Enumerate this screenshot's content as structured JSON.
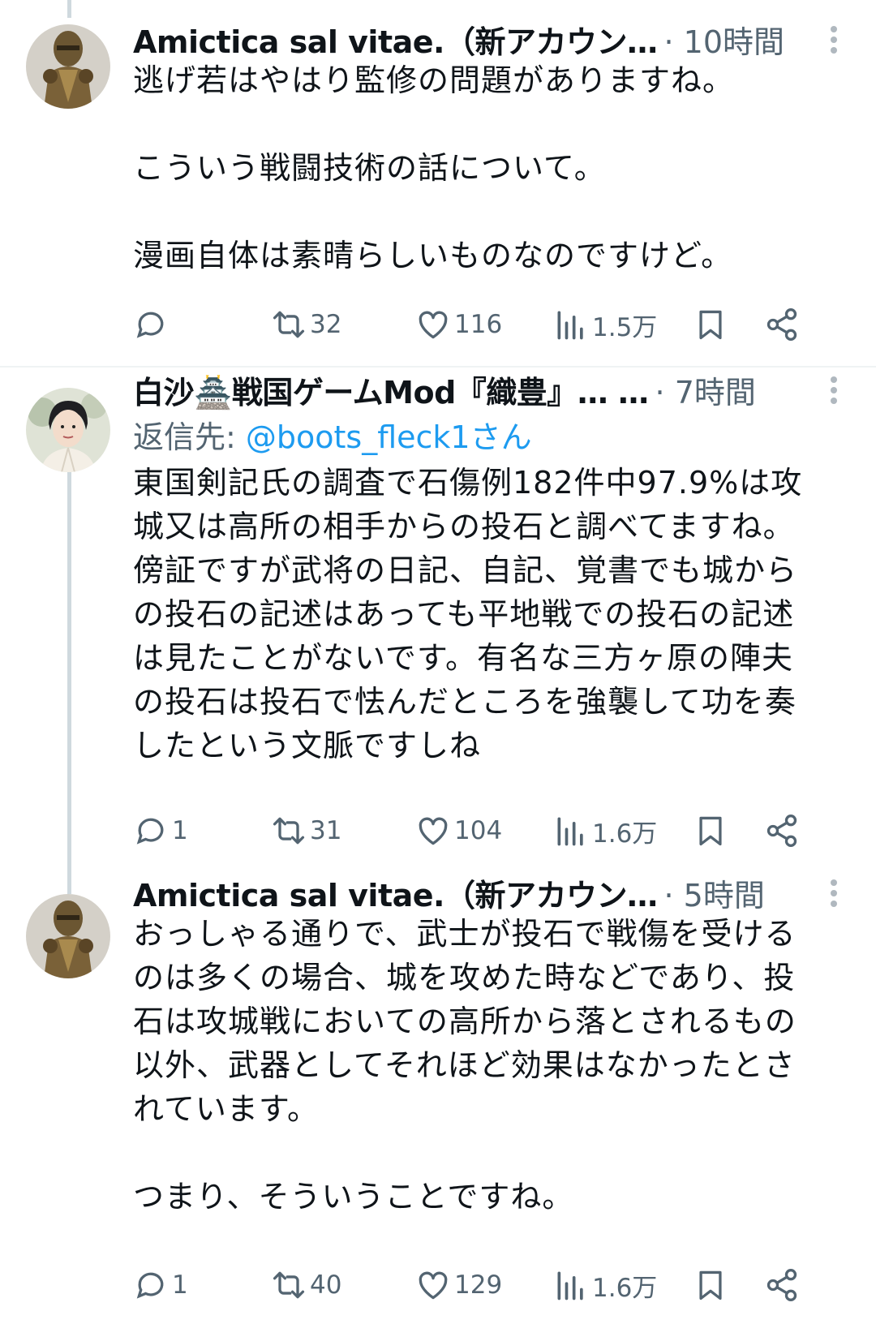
{
  "tweets": [
    {
      "name": "Amictica sal vitae.（新アカウン…",
      "time": "· 10時間",
      "lines": [
        "逃げ若はやはり監修の問題がありますね。",
        "",
        "こういう戦闘技術の話について。",
        "",
        "漫画自体は素晴らしいものなのですけど。"
      ],
      "stats": {
        "replies": "",
        "retweets": "32",
        "likes": "116",
        "views": "1.5万"
      },
      "avatar": "armor-avatar-icon"
    },
    {
      "name": "白沙🏯戦国ゲームMod『織豊』… …",
      "time": "· 7時間",
      "reply_prefix": "返信先: ",
      "reply_handle": "@boots_fleck1さん",
      "lines": [
        "東国剣記氏の調査で石傷例182件中97.9%は攻",
        "城又は高所の相手からの投石と調べてますね。",
        "傍証ですが武将の日記、自記、覚書でも城から",
        "の投石の記述はあっても平地戦での投石の記述",
        "は見たことがないです。有名な三方ヶ原の陣夫",
        "の投石は投石で怯んだところを強襲して功を奏",
        "したという文脈ですしね"
      ],
      "stats": {
        "replies": "1",
        "retweets": "31",
        "likes": "104",
        "views": "1.6万"
      },
      "avatar": "portrait-avatar-icon"
    },
    {
      "name": "Amictica sal vitae.（新アカウン…",
      "time": "· 5時間",
      "lines": [
        "おっしゃる通りで、武士が投石で戦傷を受ける",
        "のは多くの場合、城を攻めた時などであり、投",
        "石は攻城戦においての高所から落とされるもの",
        "以外、武器としてそれほど効果はなかったとさ",
        "れています。",
        "",
        "つまり、そういうことですね。"
      ],
      "stats": {
        "replies": "1",
        "retweets": "40",
        "likes": "129",
        "views": "1.6万"
      },
      "avatar": "armor-avatar-icon"
    }
  ],
  "colors": {
    "muted": "#536471",
    "link": "#1d9bf0",
    "thread": "#cfd9de"
  }
}
